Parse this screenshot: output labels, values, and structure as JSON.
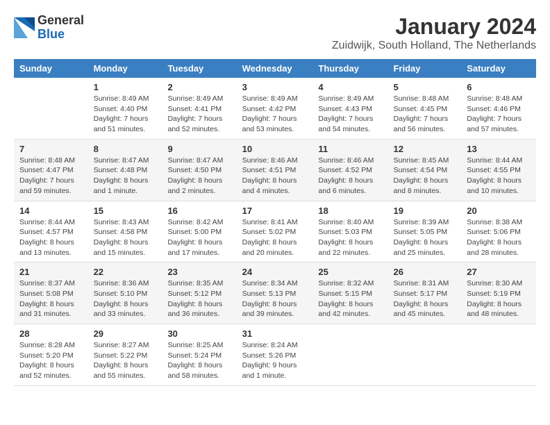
{
  "header": {
    "logo_general": "General",
    "logo_blue": "Blue",
    "month_title": "January 2024",
    "location": "Zuidwijk, South Holland, The Netherlands"
  },
  "weekdays": [
    "Sunday",
    "Monday",
    "Tuesday",
    "Wednesday",
    "Thursday",
    "Friday",
    "Saturday"
  ],
  "weeks": [
    [
      {
        "day": "",
        "info": ""
      },
      {
        "day": "1",
        "info": "Sunrise: 8:49 AM\nSunset: 4:40 PM\nDaylight: 7 hours\nand 51 minutes."
      },
      {
        "day": "2",
        "info": "Sunrise: 8:49 AM\nSunset: 4:41 PM\nDaylight: 7 hours\nand 52 minutes."
      },
      {
        "day": "3",
        "info": "Sunrise: 8:49 AM\nSunset: 4:42 PM\nDaylight: 7 hours\nand 53 minutes."
      },
      {
        "day": "4",
        "info": "Sunrise: 8:49 AM\nSunset: 4:43 PM\nDaylight: 7 hours\nand 54 minutes."
      },
      {
        "day": "5",
        "info": "Sunrise: 8:48 AM\nSunset: 4:45 PM\nDaylight: 7 hours\nand 56 minutes."
      },
      {
        "day": "6",
        "info": "Sunrise: 8:48 AM\nSunset: 4:46 PM\nDaylight: 7 hours\nand 57 minutes."
      }
    ],
    [
      {
        "day": "7",
        "info": "Sunrise: 8:48 AM\nSunset: 4:47 PM\nDaylight: 7 hours\nand 59 minutes."
      },
      {
        "day": "8",
        "info": "Sunrise: 8:47 AM\nSunset: 4:48 PM\nDaylight: 8 hours\nand 1 minute."
      },
      {
        "day": "9",
        "info": "Sunrise: 8:47 AM\nSunset: 4:50 PM\nDaylight: 8 hours\nand 2 minutes."
      },
      {
        "day": "10",
        "info": "Sunrise: 8:46 AM\nSunset: 4:51 PM\nDaylight: 8 hours\nand 4 minutes."
      },
      {
        "day": "11",
        "info": "Sunrise: 8:46 AM\nSunset: 4:52 PM\nDaylight: 8 hours\nand 6 minutes."
      },
      {
        "day": "12",
        "info": "Sunrise: 8:45 AM\nSunset: 4:54 PM\nDaylight: 8 hours\nand 8 minutes."
      },
      {
        "day": "13",
        "info": "Sunrise: 8:44 AM\nSunset: 4:55 PM\nDaylight: 8 hours\nand 10 minutes."
      }
    ],
    [
      {
        "day": "14",
        "info": "Sunrise: 8:44 AM\nSunset: 4:57 PM\nDaylight: 8 hours\nand 13 minutes."
      },
      {
        "day": "15",
        "info": "Sunrise: 8:43 AM\nSunset: 4:58 PM\nDaylight: 8 hours\nand 15 minutes."
      },
      {
        "day": "16",
        "info": "Sunrise: 8:42 AM\nSunset: 5:00 PM\nDaylight: 8 hours\nand 17 minutes."
      },
      {
        "day": "17",
        "info": "Sunrise: 8:41 AM\nSunset: 5:02 PM\nDaylight: 8 hours\nand 20 minutes."
      },
      {
        "day": "18",
        "info": "Sunrise: 8:40 AM\nSunset: 5:03 PM\nDaylight: 8 hours\nand 22 minutes."
      },
      {
        "day": "19",
        "info": "Sunrise: 8:39 AM\nSunset: 5:05 PM\nDaylight: 8 hours\nand 25 minutes."
      },
      {
        "day": "20",
        "info": "Sunrise: 8:38 AM\nSunset: 5:06 PM\nDaylight: 8 hours\nand 28 minutes."
      }
    ],
    [
      {
        "day": "21",
        "info": "Sunrise: 8:37 AM\nSunset: 5:08 PM\nDaylight: 8 hours\nand 31 minutes."
      },
      {
        "day": "22",
        "info": "Sunrise: 8:36 AM\nSunset: 5:10 PM\nDaylight: 8 hours\nand 33 minutes."
      },
      {
        "day": "23",
        "info": "Sunrise: 8:35 AM\nSunset: 5:12 PM\nDaylight: 8 hours\nand 36 minutes."
      },
      {
        "day": "24",
        "info": "Sunrise: 8:34 AM\nSunset: 5:13 PM\nDaylight: 8 hours\nand 39 minutes."
      },
      {
        "day": "25",
        "info": "Sunrise: 8:32 AM\nSunset: 5:15 PM\nDaylight: 8 hours\nand 42 minutes."
      },
      {
        "day": "26",
        "info": "Sunrise: 8:31 AM\nSunset: 5:17 PM\nDaylight: 8 hours\nand 45 minutes."
      },
      {
        "day": "27",
        "info": "Sunrise: 8:30 AM\nSunset: 5:19 PM\nDaylight: 8 hours\nand 48 minutes."
      }
    ],
    [
      {
        "day": "28",
        "info": "Sunrise: 8:28 AM\nSunset: 5:20 PM\nDaylight: 8 hours\nand 52 minutes."
      },
      {
        "day": "29",
        "info": "Sunrise: 8:27 AM\nSunset: 5:22 PM\nDaylight: 8 hours\nand 55 minutes."
      },
      {
        "day": "30",
        "info": "Sunrise: 8:25 AM\nSunset: 5:24 PM\nDaylight: 8 hours\nand 58 minutes."
      },
      {
        "day": "31",
        "info": "Sunrise: 8:24 AM\nSunset: 5:26 PM\nDaylight: 9 hours\nand 1 minute."
      },
      {
        "day": "",
        "info": ""
      },
      {
        "day": "",
        "info": ""
      },
      {
        "day": "",
        "info": ""
      }
    ]
  ]
}
